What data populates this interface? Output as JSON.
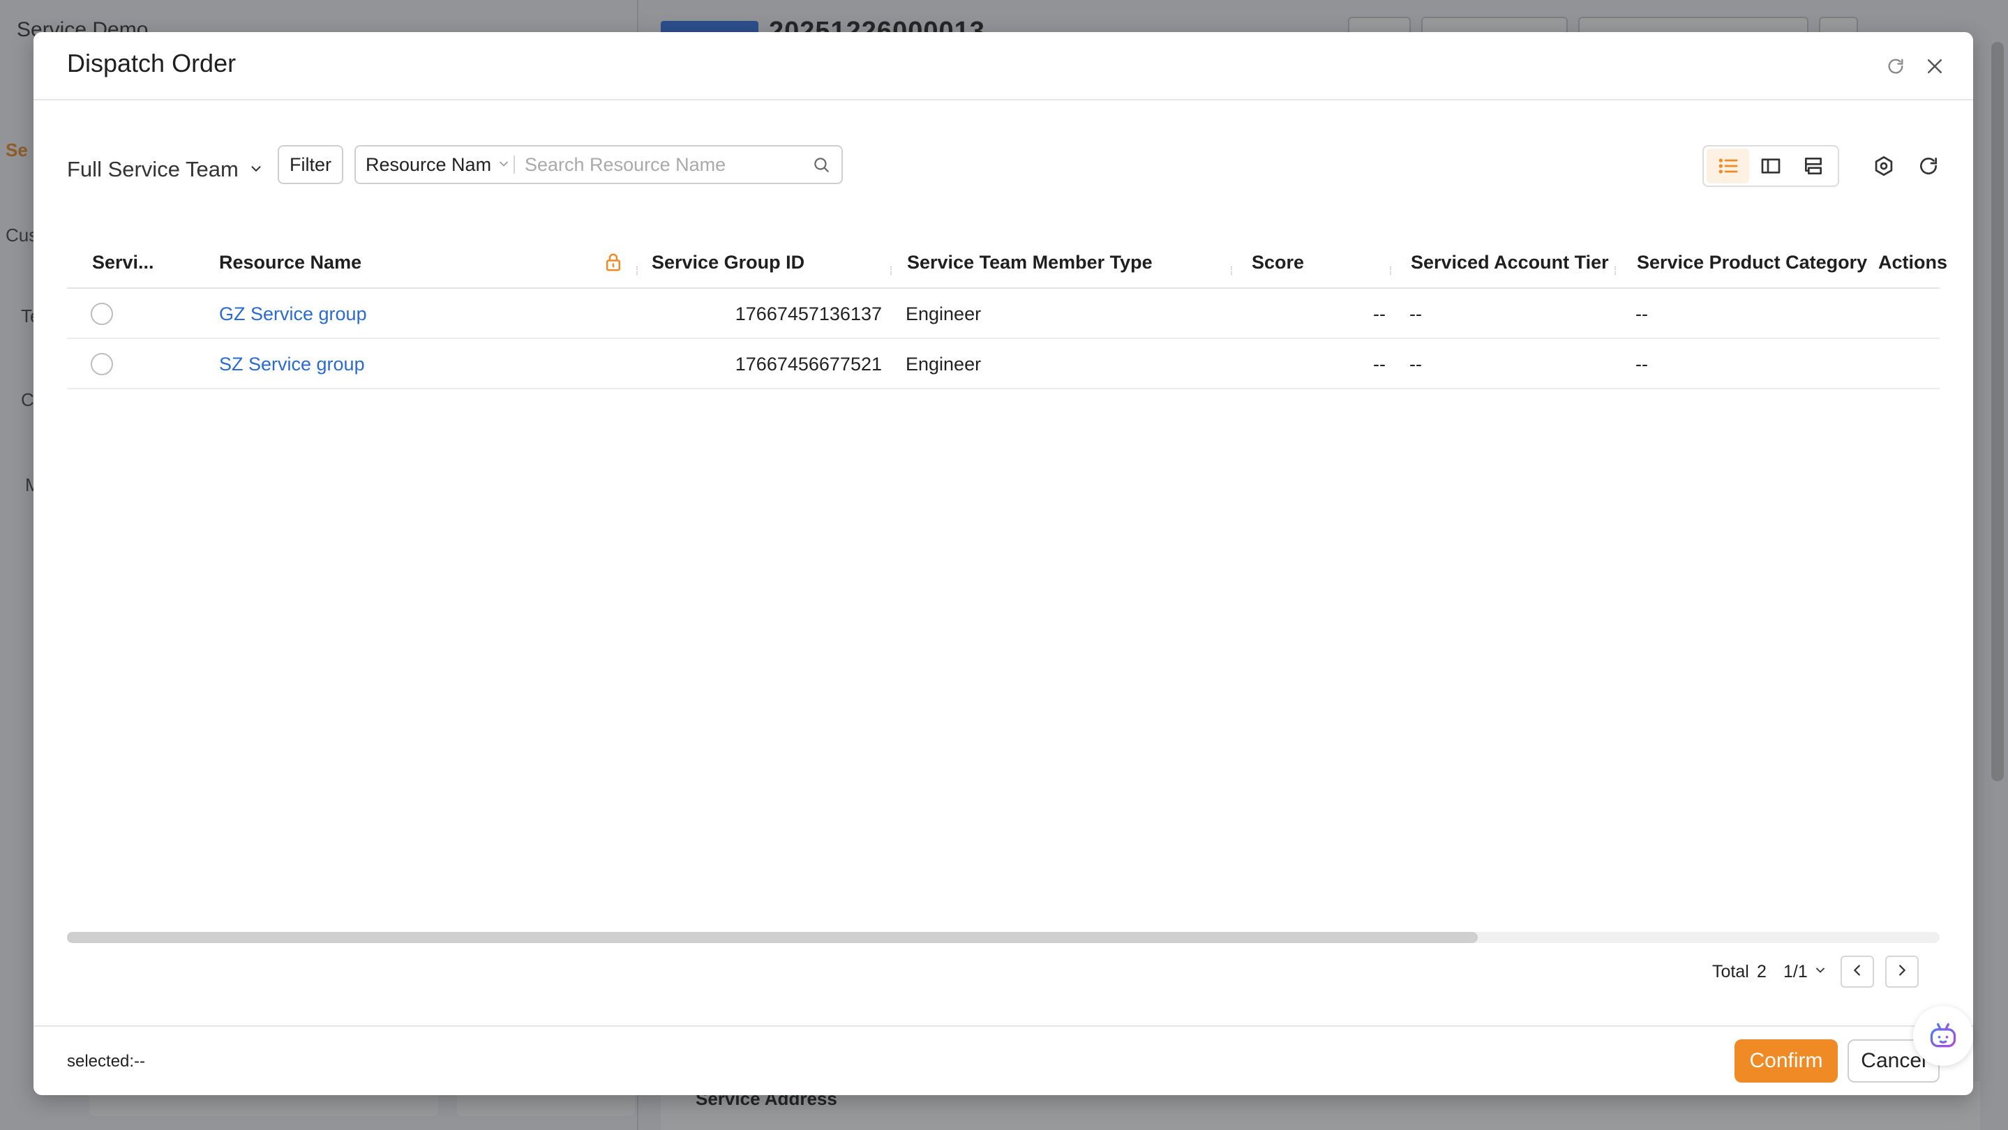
{
  "background": {
    "app_title": "Service Demo",
    "side_labels": [
      "Se",
      "Cus",
      "Te",
      "C",
      "M"
    ],
    "work_order_number": "20251226000013",
    "section_title": "Service Address"
  },
  "modal": {
    "title": "Dispatch Order"
  },
  "toolbar": {
    "team_select": "Full Service Team",
    "filter_label": "Filter",
    "search_field": "Resource Nam",
    "search_placeholder": "Search Resource Name"
  },
  "table": {
    "columns": [
      "Servi...",
      "Resource Name",
      "Service Group ID",
      "Service Team Member Type",
      "Score",
      "Serviced Account Tier",
      "Service Product Category",
      "Actions"
    ],
    "rows": [
      {
        "resource_name": "GZ Service group",
        "group_id": "17667457136137",
        "member_type": "Engineer",
        "score": "--",
        "account_tier": "--",
        "product_category": "--",
        "actions": ""
      },
      {
        "resource_name": "SZ Service group",
        "group_id": "17667456677521",
        "member_type": "Engineer",
        "score": "--",
        "account_tier": "--",
        "product_category": "--",
        "actions": ""
      }
    ]
  },
  "pagination": {
    "total_label": "Total",
    "total": "2",
    "page": "1/1"
  },
  "footer": {
    "selected_text": "selected:--",
    "confirm_label": "Confirm",
    "cancel_label": "Cancel"
  },
  "colors": {
    "accent": "#f08a24",
    "link": "#2a6bd3",
    "lock_icon": "#f08a24"
  },
  "icons": {
    "header": [
      "refresh-icon",
      "close-icon"
    ],
    "views": [
      "list-view-icon",
      "split-view-icon",
      "board-view-icon"
    ],
    "tools": [
      "settings-icon",
      "reload-icon"
    ],
    "other": [
      "lock-icon",
      "search-icon",
      "chevron-down-icon",
      "chevron-left-icon",
      "chevron-right-icon",
      "assistant-bot-icon"
    ]
  }
}
